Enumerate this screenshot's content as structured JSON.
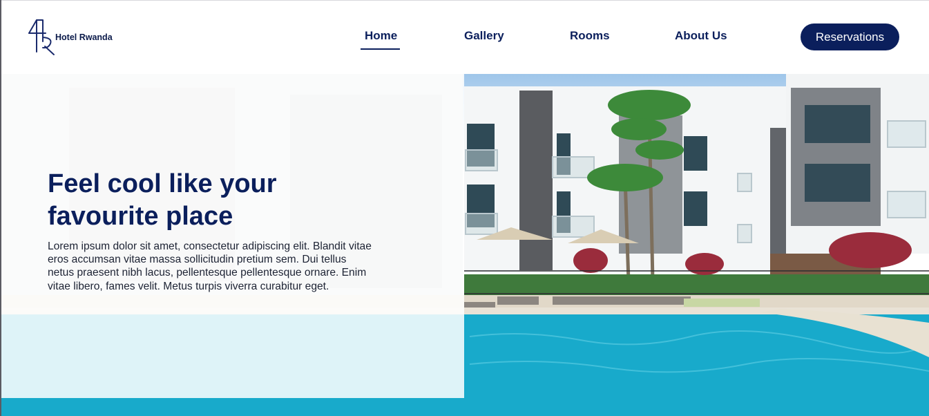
{
  "brand": {
    "name": "Hotel Rwanda",
    "logo": "hr-monogram-logo"
  },
  "nav": {
    "items": [
      {
        "label": "Home",
        "active": true
      },
      {
        "label": "Gallery",
        "active": false
      },
      {
        "label": "Rooms",
        "active": false
      },
      {
        "label": "About Us",
        "active": false
      }
    ],
    "cta": "Reservations"
  },
  "hero": {
    "headline": "Feel cool like your favourite place",
    "body": "Lorem ipsum dolor sit amet, consectetur adipiscing elit. Blandit vitae eros accumsan vitae massa sollicitudin pretium sem. Dui tellus netus praesent nibh lacus, pellentesque pellentesque ornare. Enim vitae libero, fames velit. Metus turpis viverra curabitur eget.",
    "image": "hotel-pool-photo"
  },
  "colors": {
    "primary": "#0b1f5c",
    "pool": "#14a6c8"
  }
}
